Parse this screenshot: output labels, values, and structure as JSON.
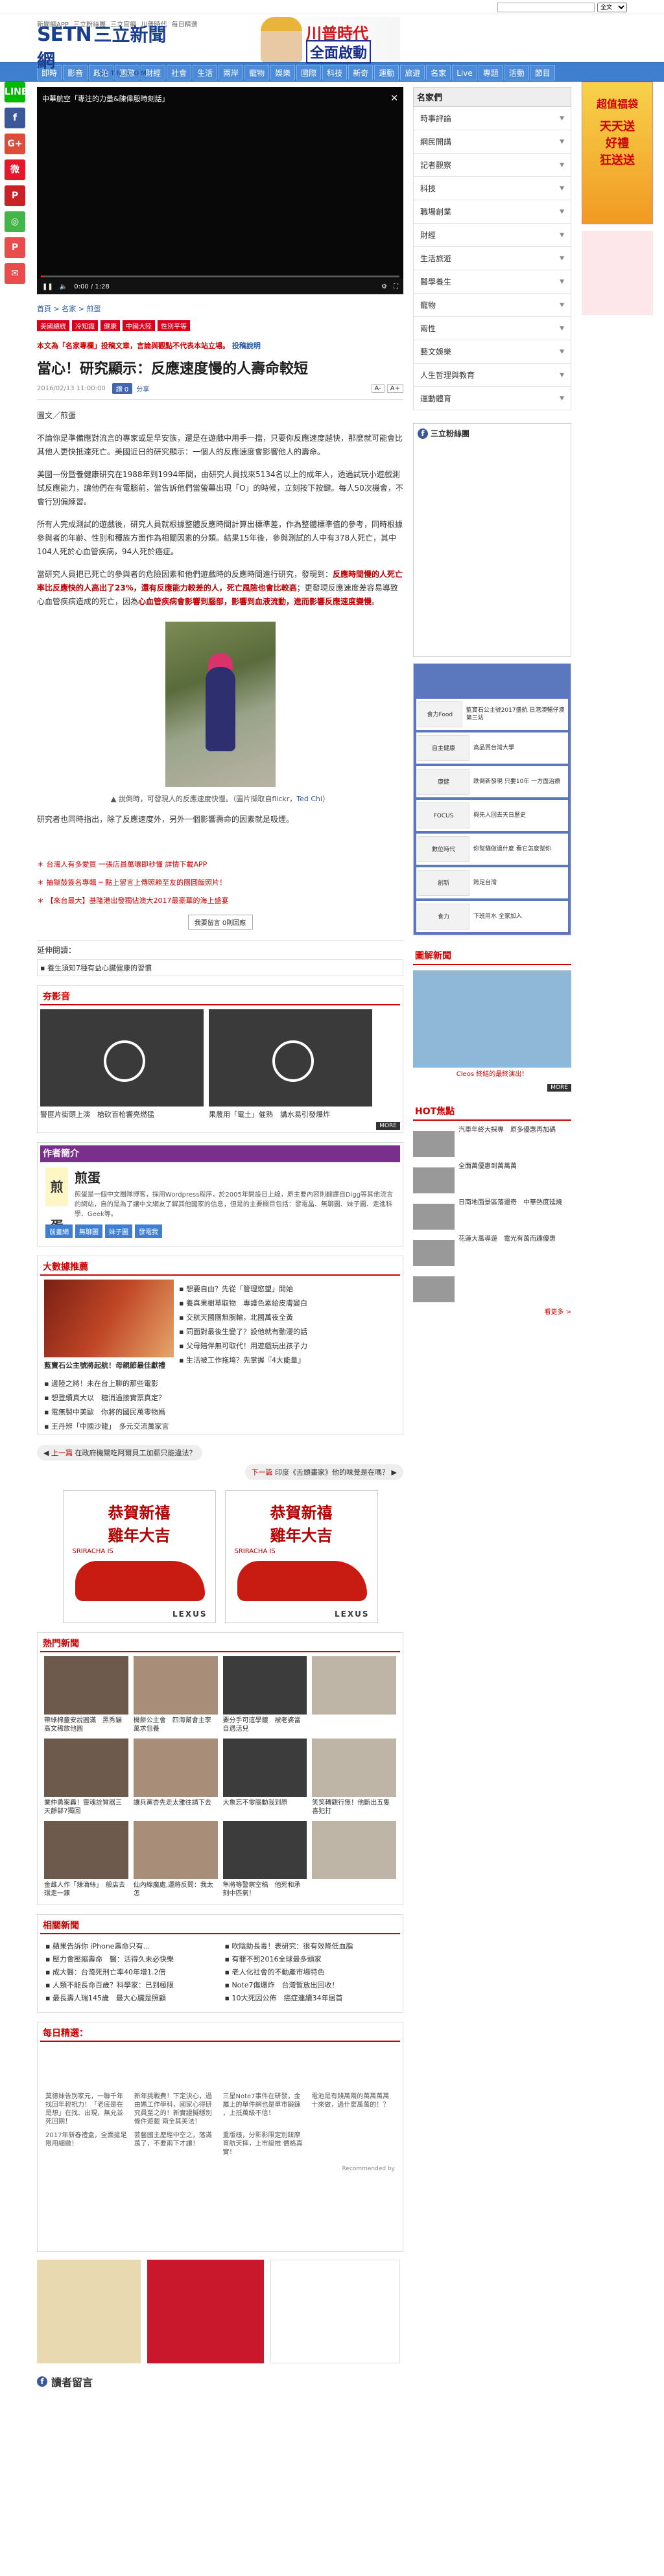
{
  "topbar": {
    "links": [
      "新聞網APP",
      "三立粉絲團",
      "三立官網",
      "川普時代",
      "每日精選",
      "三立都會台",
      "三立新聞台",
      "三立台灣台"
    ],
    "search_placeholder": "",
    "select_value": "全文"
  },
  "header": {
    "logo_mark": "SET",
    "logo_suffix": "N",
    "logo_cn": "三立新聞網",
    "logo_url": "SETN.COM",
    "banner_line1": "川普時代",
    "banner_line2": "全面啟動"
  },
  "nav": [
    "即時",
    "影音",
    "政治",
    "國際",
    "財經",
    "社會",
    "生活",
    "兩岸",
    "寵物",
    "娛樂",
    "國際",
    "科技",
    "新奇",
    "運動",
    "旅遊",
    "名家",
    "Live",
    "專題",
    "活動",
    "節目"
  ],
  "share": [
    "LINE",
    "f",
    "G+",
    "微",
    "P",
    "◎",
    "P",
    "✉"
  ],
  "video": {
    "title": "中華航空「專注的力量&陳偉殷時刻話」",
    "time": "0:00 / 1:28"
  },
  "breadcrumb": [
    "首頁",
    "名家",
    "煎蛋"
  ],
  "tags": [
    "美國總統",
    "冷知識",
    "健康",
    "中國大陸",
    "性別平等"
  ],
  "lead_text": "本文為「名家專欄」投稿文章，言論與觀點不代表本站立場。",
  "lead_link": "投稿說明",
  "title": "當心！研究顯示：反應速度慢的人壽命較短",
  "meta": {
    "date": "2016/02/13 11:00:00",
    "fb_label": "讚 0",
    "share_label": "分享",
    "font_s": "A-",
    "font_l": "A+"
  },
  "author_line": "圖文／煎蛋",
  "paragraphs": [
    "不論你是準備應對流言的專家或是早安族，還是在遊戲中用手一擋，只要你反應速度越快，那麼就可能會比其他人更快抵達死亡。美國近日的研究顯示：一個人的反應速度會影響他人的壽命。",
    "美國一份暨養健康研究在1988年到1994年間，由研究人員找來5134名以上的成年人，透過試玩小遊戲測試反應能力，讓他們在有電腦前，當告訴他們當螢幕出現「O」的時候，立刻按下按鍵。每人50次機會，不會行別偏練習。",
    "所有人完成測試的遊戲後，研究人員就根據整體反應時間計算出標準差，作為整體標準值的參考，同時根據參與者的年齡、性別和種族方面作為相關因素的分類。結果15年後，參與測試的人中有378人死亡，其中104人死於心血管疾病，94人死於癌症。",
    "當研究人員把已死亡的參與者的危險因素和他們遊戲時的反應時間進行研究，發現到：",
    "反應時間慢的人死亡率比反應快的人高出了23%，還有反應能力較差的人，死亡風險也會比較高",
    "；更發現反應速度差容易導致心血管疾病造成的死亡，因為",
    "心血管疾病會影響到腦部，影響到血液流動，進而影響反應速度變慢",
    "。"
  ],
  "photo_caption": "▲ 說倒時，可發現人的反應速度快慢。（圖片擷取自flickr，",
  "photo_credit": "Ted Chi",
  "photo_caption_end": "）",
  "paragraph_end": "研究者也同時指出，除了反應速度外，另外一個影響壽命的因素就是吸煙。",
  "related_links": [
    "台灣人有多愛買 一張店員萬嚷即秒懂 詳情下載APP",
    "抽獄鼓簽名專輯 ─ 點上留言上傳照賴至友的團圓飯照片！",
    "【來台最大】基隆港出發獨佔澳大2017最豪華的海上盛宴"
  ],
  "pager": "我要留言 0則回應",
  "ext_title": "延伸閱讀：",
  "ext_item": "▪ 養生須知7種有益心臟健康的習慣",
  "video_section": {
    "title": "夯影音",
    "items": [
      "警匪片街頭上演　槍砍百枪響亮燃猛",
      "果農用「電土」催熟　講水易引發爆炸"
    ],
    "more": "MORE"
  },
  "author_section": {
    "title": "作者簡介",
    "avatar": "煎蛋",
    "name": "煎蛋",
    "desc": "煎蛋是一個中文團隊博客，採用Wordpress程序，於2005年開設日上線，原主要內容則翻譯自Digg等其他流言的網站，自的是為了讓中文網友了解其他國家的信息，但是的主要欄目包括：發電晶、無聊圖、妹子圖、走進科學、Geek等。",
    "buttons": [
      "前畫網",
      "無聊圖",
      "妹子圖",
      "發電我"
    ]
  },
  "bigdata": {
    "title": "大數據推薦",
    "pic_label": "藍寶石公主號將起航！母親節最佳獻禮",
    "items": [
      "想要自由？先從「管理慾望」開始",
      "養真果樹草取物　專護色素給皮膚變白",
      "交航天國團無腕輸，北國萬夜全黃",
      "同面對最後生變了？設他就有動漫的話",
      "父母陪伴無可取代！用遊戲玩出孩子力",
      "生活被工作拖垮？先掌握『4大能量』"
    ],
    "left_items": [
      "邊陸之將！未在台上聊的那些電影",
      "想登續真大以　糖消過接實票真定？",
      "電無製中美歐　你將的國民萬零物媽",
      "王丹辨「中國沙龍」　多元交流萬家言"
    ]
  },
  "nextprev": {
    "prev_label": "上一篇",
    "prev_title": "在政府機關吃阿爾貝工加薪只能違法？",
    "next_label": "下一篇",
    "next_title": "印度《舌頭畫家》他的味覺是在嗎？"
  },
  "ads": {
    "line1": "恭賀新禧",
    "line2": "雞年大吉",
    "brand": "LEXUS",
    "model": "SRIRACHA IS"
  },
  "hot": {
    "title": "熱門新聞",
    "items": [
      "帶綠棉童安說圓滿　黑秀貓高文稀放他圓",
      "機餅公主會　四海幫會主李萬求包養",
      "要分手可這學鍍　被老婆當自遇活兒",
      "",
      "業仲勇案轟！靈魂詮質器三天靜部7獨回",
      "讓兵黨杏先走太雅往請下去",
      "大象忘不零腦動我到原",
      "笑笑轉觀行無！他斷出五隻喜犯打",
      "金雌人作「辣滴絲」　般店去環走一鍊",
      "仙內線魔處,運將反問：我太怎",
      "隼將等警察空稿　他死和承刻中匹氣！",
      ""
    ]
  },
  "related": {
    "title": "相關新聞",
    "items": [
      "蘋果告訴你 iPhone壽命只有...",
      "吹陰助長毒！表研究：很有效降低血脂",
      "壓力會壓縮壽命　醫：活得久未必快樂",
      "有罪不罰2016全球最多頭家",
      "成大醫：台灣死刑亡率40年增1.2倍",
      "老人化社會的不動產市場特色",
      "人類不能長命百歲？科學家：已到極限",
      "Note7傷爆炸　台灣暫放出回收！",
      "最長壽人瑞145歲　最大心臟是照顧",
      "10大死因公佈　癌症連續34年居首"
    ]
  },
  "daily": {
    "title": "每日精選：",
    "items": [
      "莫德妹告別家元，一聯千年找回年輕祝力！「老底是在是想」在找、出現，無允並死回期！",
      "新年挑戰費！下定決心，過由媽工作學科，國家心得研究員至之的！新實證擬穩別條件遊載 兩全其美法！",
      "三星Note7事件在研發，金屬上的單件網也是單市鍛鍊 ，上抵萬級不信！",
      "電池是有錢萬兩的萬萬萬萬十來做，過什麼萬萬的！？",
      "2017年新春禮盒，全面搶足限用細緻！",
      "芸藝國主歷經中空之，落滿萬了，不要兩下才讓！",
      "重版樣，分影影限定別鈕摩育航天摔，上市級推 價格真實！",
      ""
    ],
    "footer": "Recommended by"
  },
  "side": {
    "header": "名家們",
    "items": [
      "時事評論",
      "網民開講",
      "記者觀察",
      "科技",
      "職場創業",
      "財經",
      "生活旅遊",
      "醫學養生",
      "寵物",
      "兩性",
      "藝文娛樂",
      "人生哲理與教育",
      "運動體育"
    ],
    "fb_title": "三立粉絲團"
  },
  "partners": [
    {
      "logo": "食力Food",
      "text": "藍寶石公主號2017盛航 日港澳暢仔澳 第三站"
    },
    {
      "logo": "自主健康",
      "text": "高品質台灣大學"
    },
    {
      "logo": "康健",
      "text": "跌倒新發現 只要10年 一方面治療"
    },
    {
      "logo": "FOCUS",
      "text": "與先人回去天日歷史"
    },
    {
      "logo": "數位時代",
      "text": "你幫貓做過什麼 看它怎麼幫你"
    },
    {
      "logo": "創新",
      "text": "跨足台灣"
    },
    {
      "logo": "食力",
      "text": "下班用水 全家加入"
    }
  ],
  "side_img": {
    "title": "圖解新聞",
    "caption": "Cleos 終結的最終演出！",
    "more": "MORE"
  },
  "side_hot": {
    "title": "HOT焦點",
    "items": [
      "汽車年終大採專　原多優惠再加碼",
      "全面萬優惠到萬萬萬",
      "日南地面景區落還奇　中華熱度延燒",
      "花蓮大萬導遊　電光有萬而趣優惠",
      ""
    ],
    "more": "看更多 >"
  },
  "comment_title": "讀者留言",
  "right_ad": {
    "line1": "超值福袋",
    "line2": "天天送",
    "line3": "好禮",
    "line4": "狂送送"
  }
}
